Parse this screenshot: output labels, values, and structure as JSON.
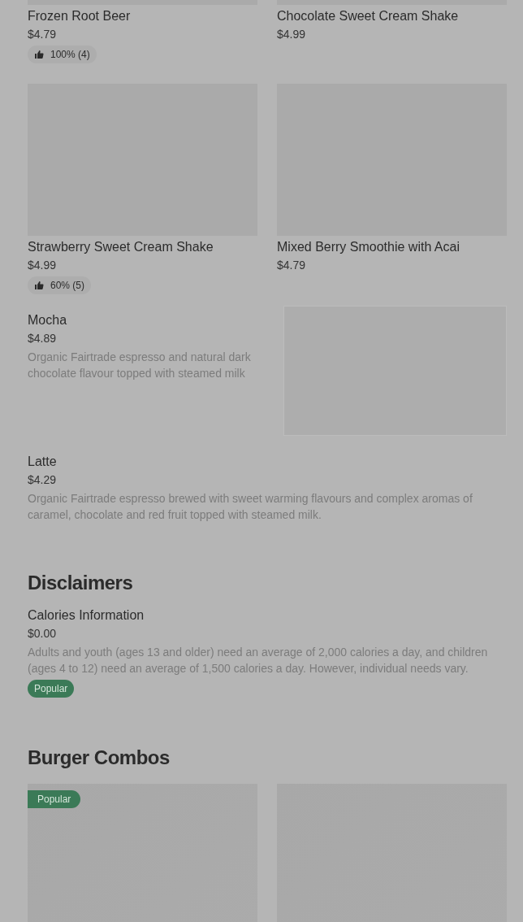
{
  "top_items": [
    {
      "name": "Frozen Root Beer",
      "price": "$4.79",
      "rating": "100% (4)"
    },
    {
      "name": "Chocolate Sweet Cream Shake",
      "price": "$4.99"
    }
  ],
  "grid_items": [
    {
      "name": "Strawberry Sweet Cream Shake",
      "price": "$4.99",
      "rating": "60% (5)"
    },
    {
      "name": "Mixed Berry Smoothie with Acai",
      "price": "$4.79"
    }
  ],
  "list_items": [
    {
      "name": "Mocha",
      "price": "$4.89",
      "description": "Organic Fairtrade espresso and natural dark chocolate flavour topped with steamed milk",
      "has_image": true
    },
    {
      "name": "Latte",
      "price": "$4.29",
      "description": "Organic Fairtrade espresso brewed with sweet warming flavours and complex aromas of caramel, chocolate and red fruit topped with steamed milk.",
      "has_image": false
    }
  ],
  "disclaimers": {
    "title": "Disclaimers",
    "items": [
      {
        "name": "Calories Information",
        "price": "$0.00",
        "description": "Adults and youth (ages 13 and older) need an average of 2,000 calories a day, and children (ages 4 to 12) need an average of 1,500 calories a day. However, individual needs vary.",
        "badge": "Popular"
      }
    ]
  },
  "burger_combos": {
    "title": "Burger Combos",
    "cards": [
      {
        "kind": "badged",
        "badge": "Popular"
      },
      {
        "kind": "plain"
      }
    ]
  }
}
